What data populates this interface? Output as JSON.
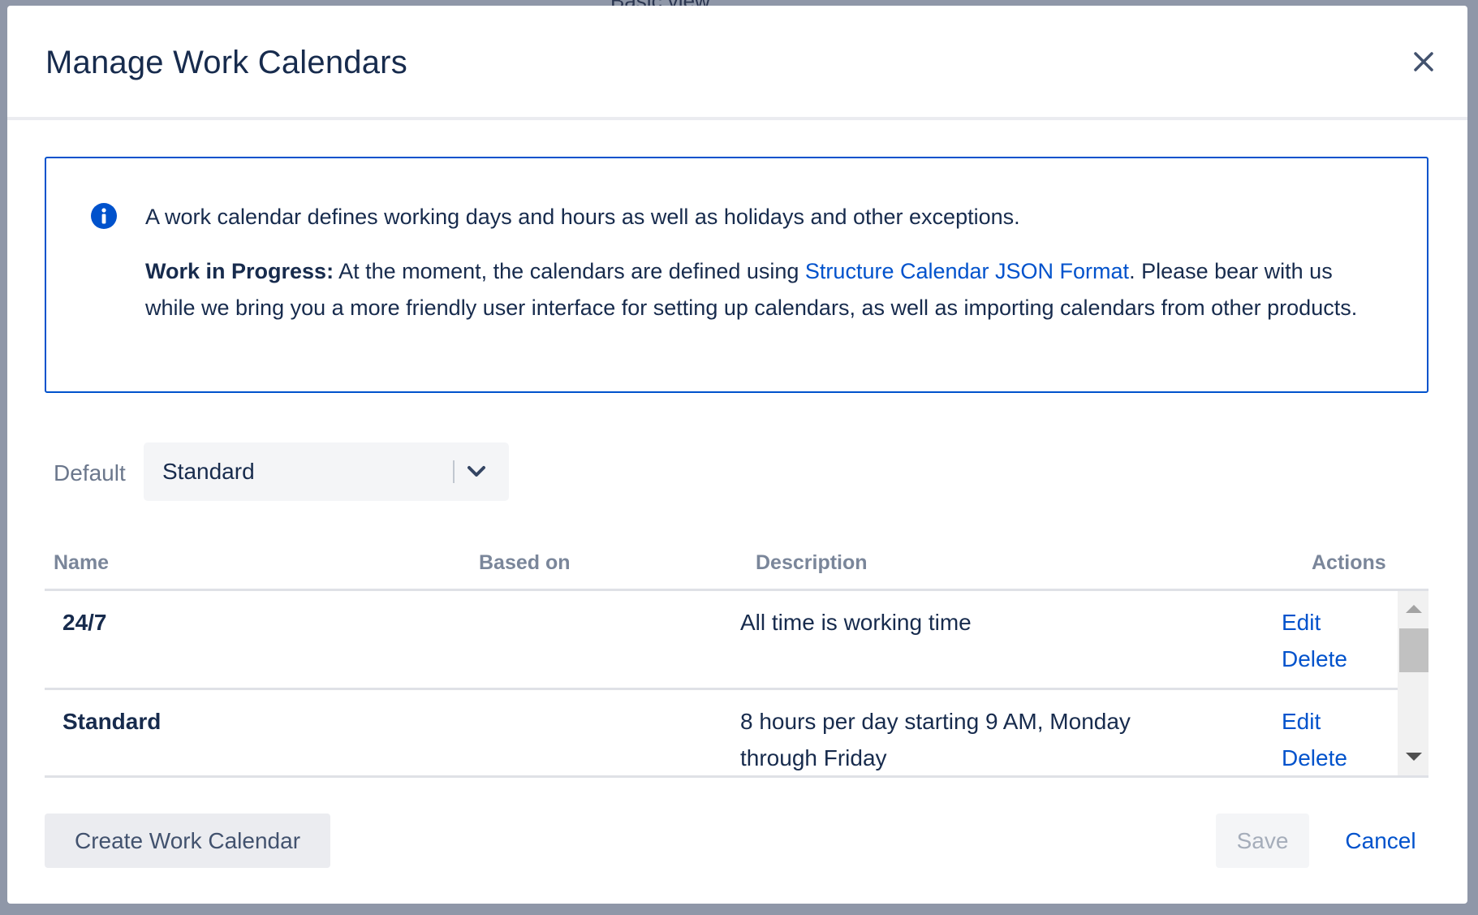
{
  "background": {
    "partial_text": "Basic view"
  },
  "dialog": {
    "title": "Manage Work Calendars",
    "close_icon": "close-icon"
  },
  "info": {
    "icon": "info-icon",
    "line1": "A work calendar defines working days and hours as well as holidays and other exceptions.",
    "wip_label": "Work in Progress:",
    "wip_text_before": " At the moment, the calendars are defined using ",
    "wip_link": "Structure Calendar JSON Format",
    "wip_text_after": ". Please bear with us while we bring you a more friendly user interface for setting up calendars, as well as importing calendars from other products."
  },
  "default_select": {
    "label": "Default",
    "value": "Standard"
  },
  "table": {
    "headers": {
      "name": "Name",
      "based_on": "Based on",
      "description": "Description",
      "actions": "Actions"
    },
    "rows": [
      {
        "name": "24/7",
        "based_on": "",
        "description": "All time is working time",
        "edit": "Edit",
        "delete": "Delete"
      },
      {
        "name": "Standard",
        "based_on": "",
        "description": "8 hours per day starting 9 AM, Monday through Friday",
        "edit": "Edit",
        "delete": "Delete"
      }
    ]
  },
  "footer": {
    "create_label": "Create Work Calendar",
    "save_label": "Save",
    "cancel_label": "Cancel"
  },
  "colors": {
    "accent": "#0052cc",
    "text": "#172b4d",
    "muted": "#7a869a",
    "overlay": "#8f97a8"
  }
}
